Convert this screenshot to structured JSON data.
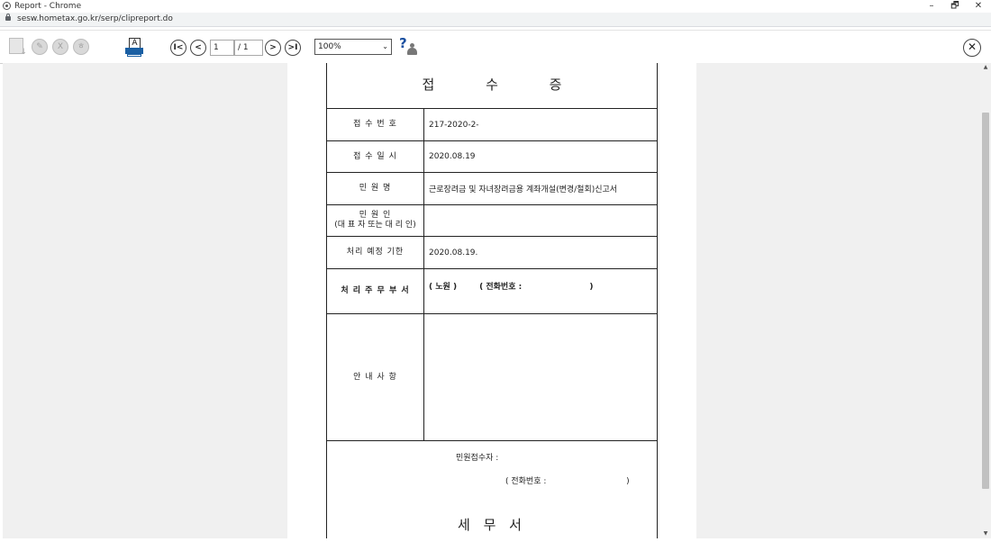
{
  "window": {
    "title": "Report - Chrome",
    "minimize": "–",
    "restore": "🗗",
    "close": "✕"
  },
  "address": {
    "url": "sesw.hometax.go.kr/serp/clipreport.do"
  },
  "toolbar": {
    "pdf_glyph": "✎",
    "excel_glyph": "X",
    "hwp_glyph": "ㅎ",
    "print_glyph": "A",
    "first": "I<",
    "prev": "<",
    "next": ">",
    "last": ">I",
    "current_page": "1",
    "total_pages": "/ 1",
    "zoom": "100%",
    "zoom_caret": "⌄",
    "help_glyph": "?",
    "close_glyph": "✕"
  },
  "form": {
    "title": "접 수 증",
    "rows": [
      {
        "label": "접 수 번 호",
        "value": "217-2020-2-"
      },
      {
        "label": "접 수 일 시",
        "value": "2020.08.19"
      },
      {
        "label": "민 원 명",
        "value": "근로장려금 및 자녀장려금용 계좌개설(변경/철회)신고서"
      },
      {
        "label": "민 원 인",
        "label2": "(대 표 자 또는 대 리 인)",
        "value": ""
      },
      {
        "label": "처리 예정 기한",
        "value": "2020.08.19."
      },
      {
        "label": "처 리 주 무 부 서",
        "value": "( 노원 )        ( 전화번호 :                        )"
      },
      {
        "label": "안 내 사 항",
        "value": ""
      }
    ],
    "receiver": "민원접수자 :",
    "receiver_phone": "( 전화번호 :                               )",
    "office": "세 무 서"
  },
  "scrollbar": {
    "up": "▲",
    "down": "▼"
  }
}
